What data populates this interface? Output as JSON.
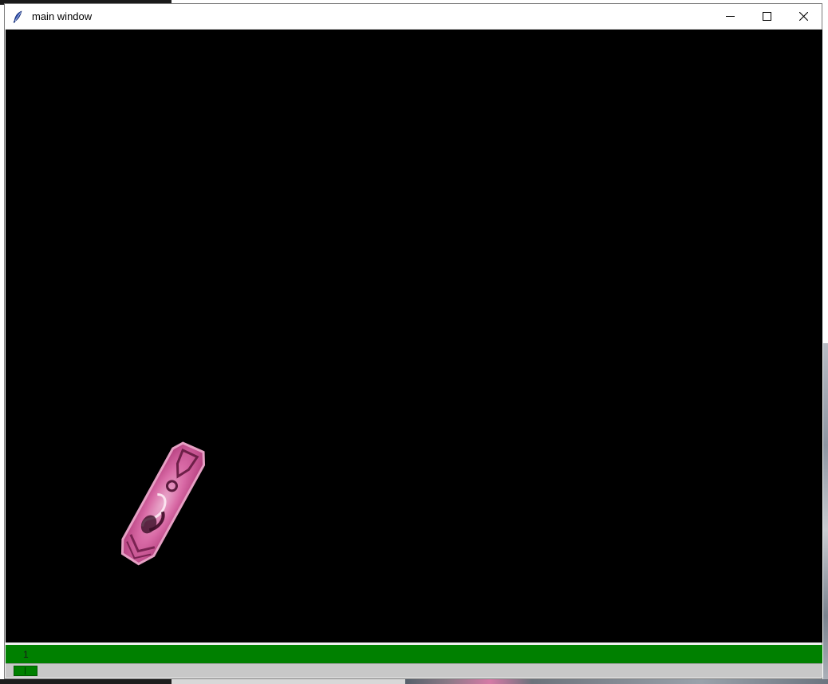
{
  "window": {
    "title": "main window",
    "icon": "feather-icon",
    "controls": {
      "minimize": "minimize-icon",
      "maximize": "maximize-icon",
      "close": "close-icon"
    }
  },
  "canvas": {
    "background_color": "#000000",
    "sprite": "pink-crystal-sprite"
  },
  "status": {
    "frame_value": "1",
    "bar_color": "#008000"
  },
  "slider": {
    "track_color": "#c8c8c8",
    "handle_color": "#008000"
  }
}
